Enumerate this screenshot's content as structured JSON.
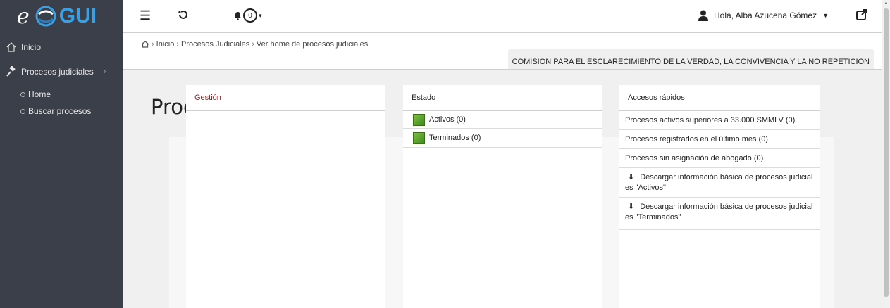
{
  "brand": {
    "e": "e",
    "gui": "GUI"
  },
  "sidebar": {
    "items": [
      {
        "label": "Inicio"
      },
      {
        "label": "Procesos judiciales"
      }
    ],
    "subitems": [
      {
        "label": "Home"
      },
      {
        "label": "Buscar procesos"
      }
    ]
  },
  "topbar": {
    "notification_count": "0",
    "user_greeting": "Hola, Alba Azucena Gómez"
  },
  "breadcrumb": {
    "items": [
      "Inicio",
      "Procesos Judiciales",
      "Ver home de procesos judiciales"
    ]
  },
  "organization": "COMISION PARA EL ESCLARECIMIENTO DE LA VERDAD, LA CONVIVENCIA Y LA NO REPETICION",
  "page_title": "Procesos Judiciales",
  "colors": {
    "sidebar": "#3a3f49",
    "gestion_title": "#8b1a1a",
    "status_green": "#5fa832",
    "brand_blue": "#3aa0e6"
  },
  "columns": {
    "gestion": {
      "title": "Gestión"
    },
    "estado": {
      "title": "Estado",
      "items": [
        {
          "label": "Activos (0)"
        },
        {
          "label": "Terminados (0)"
        }
      ]
    },
    "accesos": {
      "title": "Accesos rápidos",
      "items": [
        {
          "label": "Procesos activos superiores a 33.000 SMMLV (0)"
        },
        {
          "label": "Procesos registrados en el último mes (0)"
        },
        {
          "label": "Procesos sin asignación de abogado (0)"
        },
        {
          "label": "Descargar información básica de procesos judicial es \"Activos\""
        },
        {
          "label": "Descargar información básica de procesos judicial es \"Terminados\""
        }
      ]
    }
  }
}
